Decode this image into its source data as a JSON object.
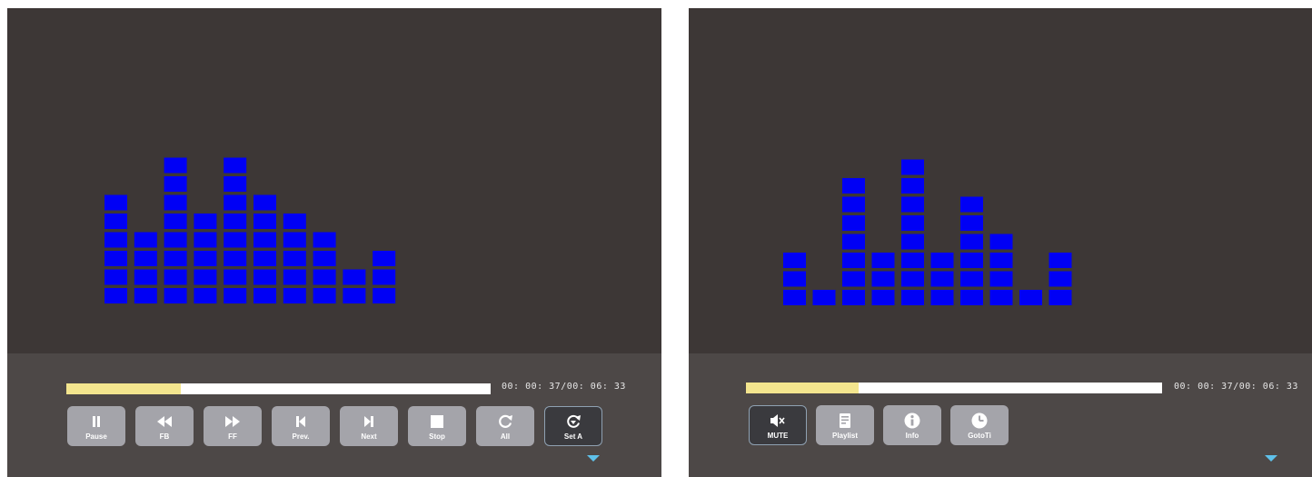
{
  "colors": {
    "screen_bg": "#3d3736",
    "panel_bg": "#4d4847",
    "bar_color": "#0000f5",
    "progress_fill": "#f3e58e",
    "progress_track": "#ffffff",
    "button_bg": "#a4a4aa",
    "arrow": "#5fc1ea"
  },
  "left_player": {
    "visualizer_levels": [
      6,
      4,
      8,
      5,
      8,
      6,
      5,
      4,
      2,
      3
    ],
    "progress_fraction": 0.27,
    "time_text": "00: 00: 37/00: 06: 33",
    "buttons": [
      {
        "name": "pause",
        "label": "Pause",
        "icon": "pause-icon"
      },
      {
        "name": "fb",
        "label": "FB",
        "icon": "rewind-icon"
      },
      {
        "name": "ff",
        "label": "FF",
        "icon": "fast-forward-icon"
      },
      {
        "name": "prev",
        "label": "Prev.",
        "icon": "skip-previous-icon"
      },
      {
        "name": "next",
        "label": "Next",
        "icon": "skip-next-icon"
      },
      {
        "name": "stop",
        "label": "Stop",
        "icon": "stop-icon"
      },
      {
        "name": "all",
        "label": "All",
        "icon": "repeat-all-icon"
      },
      {
        "name": "set-a",
        "label": "Set A",
        "icon": "repeat-ab-icon",
        "selected": true
      }
    ]
  },
  "right_player": {
    "visualizer_levels": [
      3,
      1,
      7,
      3,
      8,
      3,
      6,
      4,
      1,
      3
    ],
    "progress_fraction": 0.27,
    "time_text": "00: 00: 37/00: 06: 33",
    "buttons": [
      {
        "name": "mute",
        "label": "MUTE",
        "icon": "mute-icon",
        "selected": true
      },
      {
        "name": "playlist",
        "label": "Playlist",
        "icon": "playlist-icon"
      },
      {
        "name": "info",
        "label": "Info",
        "icon": "info-icon"
      },
      {
        "name": "goto-time",
        "label": "GotoTi",
        "icon": "clock-icon"
      }
    ]
  }
}
